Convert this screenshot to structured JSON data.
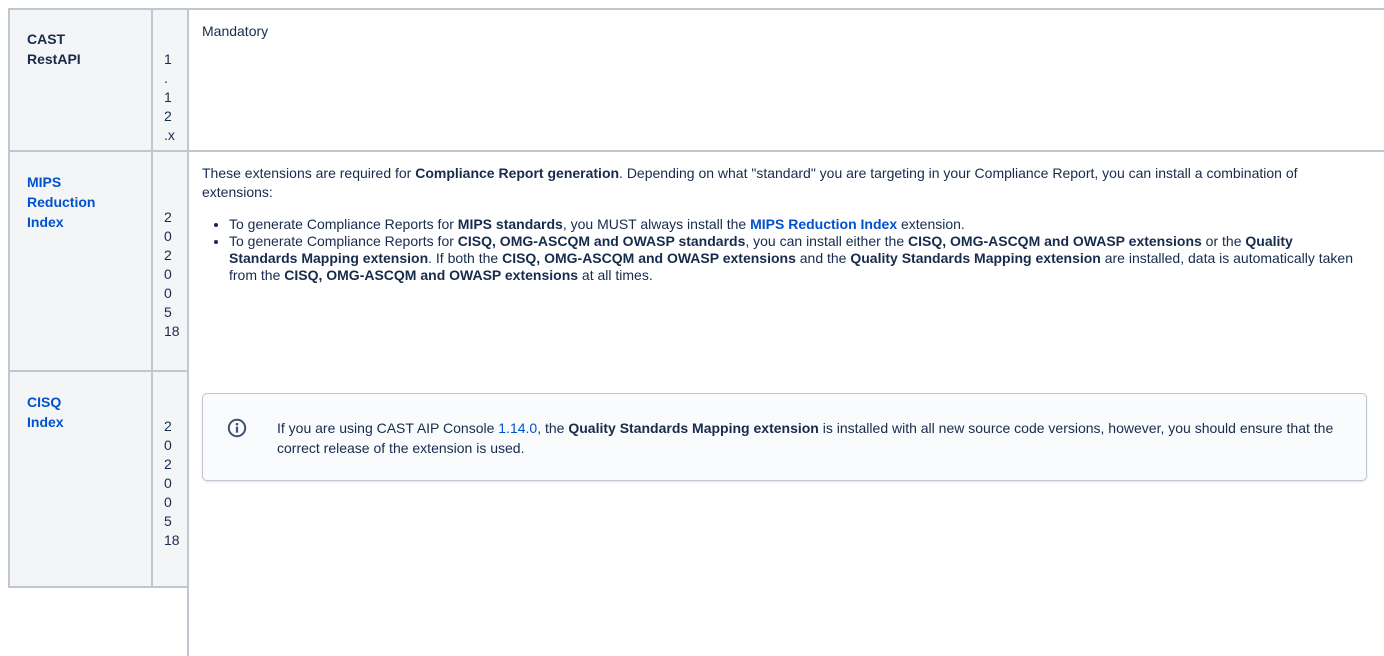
{
  "rows": [
    {
      "name_lines": [
        "CAST",
        "RestAPI"
      ],
      "version_chars": [
        "1",
        ".",
        "1",
        "2",
        ".x"
      ]
    },
    {
      "name_lines": [
        "MIPS",
        "Reduction",
        "Index"
      ],
      "version_chars": [
        "2",
        "0",
        "2",
        "0",
        "0",
        "5",
        "18"
      ]
    },
    {
      "name_lines": [
        "CISQ",
        "Index"
      ],
      "version_chars": [
        "2",
        "0",
        "2",
        "0",
        "0",
        "5",
        "18"
      ]
    }
  ],
  "row1_description": "Mandatory",
  "intro": {
    "t1": "These extensions are required for ",
    "b1": "Compliance Report generation",
    "t2": ". Depending on what \"standard\" you are targeting in your Compliance Report, you can install a combination of extensions:"
  },
  "bullet1": {
    "t1": "To generate Compliance Reports for ",
    "b1": "MIPS standards",
    "t2": ", you MUST always install the ",
    "link": "MIPS Reduction Index",
    "t3": " extension."
  },
  "bullet2": {
    "t1": "To generate Compliance Reports for ",
    "b1": "CISQ, OMG-ASCQM and OWASP standards",
    "t2": ", you can install either the ",
    "b2": "CISQ, OMG-ASCQM and OWASP extensions",
    "t3": " or the ",
    "b3": "Quality Standards Mapping extension",
    "t4": ". If both the ",
    "b4": "CISQ, OMG-ASCQM and OWASP extensions",
    "t5": " and the ",
    "b5": "Quality Standards Mapping extension",
    "t6": " are installed, data is automatically taken from the ",
    "b6": "CISQ, OMG-ASCQM and OWASP extensions",
    "t7": " at all times."
  },
  "note": {
    "icon": "info-icon",
    "t1": "If you are using CAST AIP Console ",
    "version_link": "1.14.0",
    "t2": ", the ",
    "b1": "Quality Standards Mapping extension",
    "t3": " is installed with all new source code versions, however, you should ensure that the correct release of the extension is used."
  },
  "colors": {
    "link": "#0052cc",
    "header_bg": "#f4f5f7",
    "border": "#c1c7d0",
    "text": "#172b4d"
  }
}
